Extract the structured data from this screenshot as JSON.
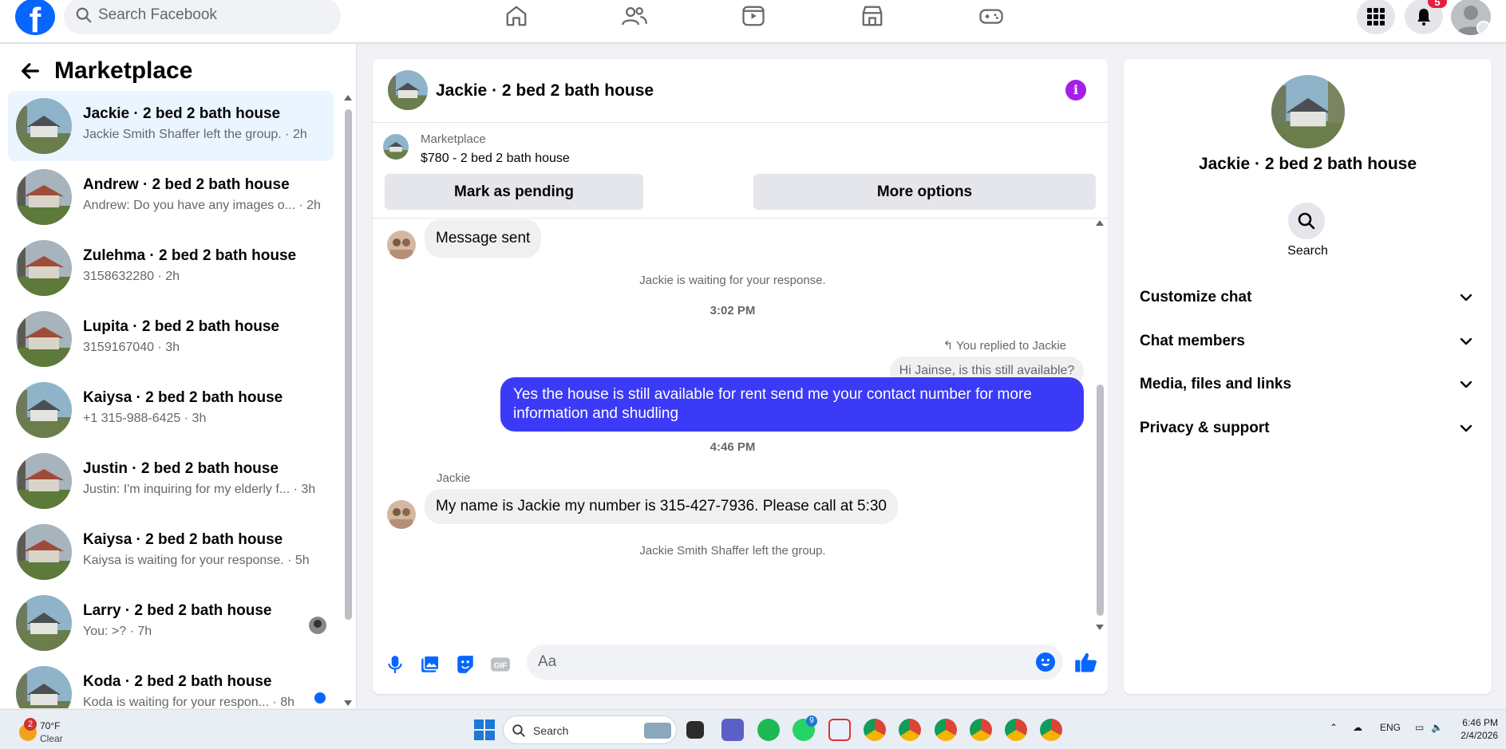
{
  "topbar": {
    "logo": "f",
    "search_placeholder": "Search Facebook",
    "nav_icons": [
      "home-icon",
      "friends-icon",
      "video-icon",
      "marketplace-icon",
      "gaming-icon"
    ],
    "notification_count": "5"
  },
  "sidebar": {
    "title": "Marketplace",
    "conversations": [
      {
        "title": "Jackie · 2 bed 2 bath house",
        "subtitle": "Jackie Smith Shaffer left the group. · 2h",
        "active": true
      },
      {
        "title": "Andrew · 2 bed 2 bath house",
        "subtitle": "Andrew: Do you have any images o... · 2h"
      },
      {
        "title": "Zulehma · 2 bed 2 bath house",
        "subtitle": "3158632280 · 2h"
      },
      {
        "title": "Lupita · 2 bed 2 bath house",
        "subtitle": "3159167040 · 3h"
      },
      {
        "title": "Kaiysa · 2 bed 2 bath house",
        "subtitle": "+1 315-988-6425 · 3h"
      },
      {
        "title": "Justin · 2 bed 2 bath house",
        "subtitle": "Justin: I'm inquiring for my elderly f... · 3h"
      },
      {
        "title": "Kaiysa · 2 bed 2 bath house",
        "subtitle": "Kaiysa is waiting for your response. · 5h"
      },
      {
        "title": "Larry · 2 bed 2 bath house",
        "subtitle": "You: >? · 7h"
      },
      {
        "title": "Koda · 2 bed 2 bath house",
        "subtitle": "Koda is waiting for your respon... · 8h"
      }
    ]
  },
  "chat": {
    "header_title": "Jackie · 2 bed 2 bath house",
    "info_glyph": "i",
    "listing": {
      "source": "Marketplace",
      "price_title": "$780 - 2 bed 2 bath house",
      "mark_pending": "Mark as pending",
      "more_options": "More options"
    },
    "messages": {
      "first_incoming": "Message sent",
      "waiting_note": "Jackie is waiting for your response.",
      "time_1": "3:02 PM",
      "reply_note": "You replied to Jackie",
      "reply_quote": "Hi Jainse, is this still available?",
      "outgoing": "Yes the house is still available for rent send me your contact number for more information and shudling",
      "time_2": "4:46 PM",
      "sender_name": "Jackie",
      "incoming_2": "My name is Jackie my number is 315-427-7936. Please call at 5:30",
      "left_note": "Jackie Smith Shaffer left the group."
    },
    "composer_placeholder": "Aa",
    "composer_icons": [
      "microphone-icon",
      "photo-icon",
      "sticker-icon",
      "gif-icon",
      "emoji-icon",
      "thumbs-up-icon"
    ]
  },
  "right_panel": {
    "title": "Jackie · 2 bed 2 bath house",
    "search_label": "Search",
    "sections": [
      "Customize chat",
      "Chat members",
      "Media, files and links",
      "Privacy & support"
    ]
  },
  "taskbar": {
    "weather_badge": "2",
    "temperature": "70°F",
    "condition": "Clear",
    "search_label": "Search",
    "whatsapp_badge": "9",
    "language": "ENG",
    "time": "6:46 PM",
    "date": "2/4/2026"
  },
  "colors": {
    "facebook_blue": "#0866ff",
    "outgoing_bubble": "#3b3af6",
    "info_purple": "#a51fe8",
    "notification_red": "#e41e3f"
  }
}
